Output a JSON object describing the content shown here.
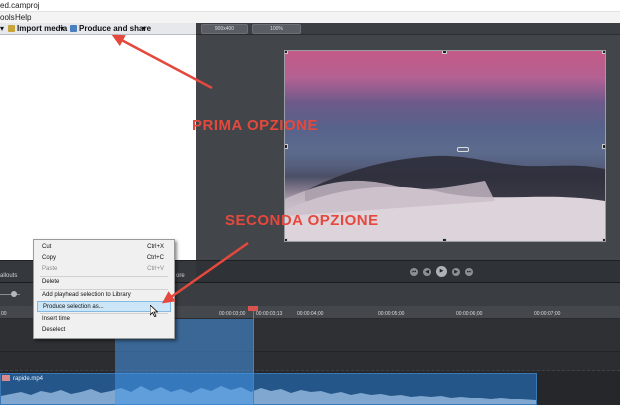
{
  "window": {
    "title": "ed.camproj"
  },
  "menu": {
    "tools": "ools",
    "help": "Help"
  },
  "toolbar": {
    "import_media": "Import media",
    "produce_share": "Produce and share",
    "dropdown_arrow": "▾"
  },
  "preview_toolbar": {
    "size_label": "900x400",
    "zoom_label": "100%"
  },
  "left_tabs": {
    "callouts": "allouts",
    "more": "ore"
  },
  "timeline": {
    "ticks": [
      "00",
      "00:00:03;00",
      "00:00:03;13",
      "00:00:04;00",
      "00:00:05;00",
      "00:00:06;00",
      "00:00:07;00"
    ],
    "clip_name": "rapide.mp4"
  },
  "context_menu": {
    "items": [
      {
        "label": "Cut",
        "shortcut": "Ctrl+X"
      },
      {
        "label": "Copy",
        "shortcut": "Ctrl+C"
      },
      {
        "label": "Paste",
        "shortcut": "Ctrl+V"
      },
      {
        "label": "Delete",
        "shortcut": ""
      },
      {
        "label": "Add playhead selection to Library",
        "shortcut": ""
      },
      {
        "label": "Produce selection as...",
        "shortcut": ""
      },
      {
        "label": "Insert time",
        "shortcut": ""
      },
      {
        "label": "Deselect",
        "shortcut": ""
      }
    ]
  },
  "annotations": {
    "first": "PRIMA OPZIONE",
    "second": "SECONDA OPZIONE"
  },
  "colors": {
    "annotation": "#e5483d",
    "selection": "#4696e6",
    "clip": "#24568a",
    "playhead": "#e04a4a"
  }
}
